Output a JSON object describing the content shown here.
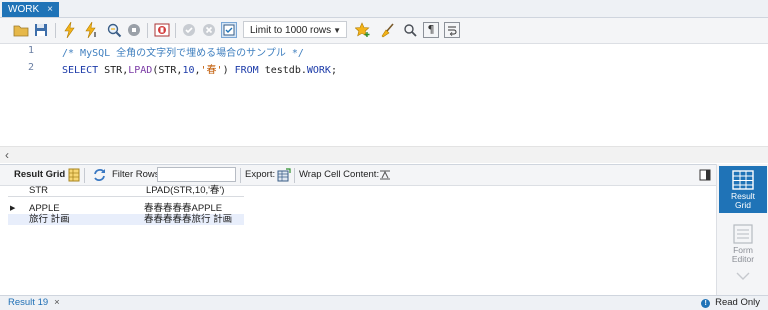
{
  "tab": {
    "title": "WORK",
    "close": "×"
  },
  "toolbar": {
    "limit_label": "Limit to 1000 rows"
  },
  "editor": {
    "lines": [
      {
        "number": "1",
        "comment": "/* MySQL 全角の文字列で埋める場合のサンプル */"
      },
      {
        "number": "2",
        "tokens": {
          "select": "SELECT",
          "cols": " STR,",
          "fn": "LPAD",
          "open": "(STR,",
          "num": "10",
          "comma": ",",
          "str": "'春'",
          "close": ")",
          "from": " FROM",
          "table_prefix": " testdb.",
          "table": "WORK",
          "end": ";"
        }
      }
    ]
  },
  "result_toolbar": {
    "result_grid": "Result Grid",
    "filter_rows": "Filter Rows:",
    "filter_value": "",
    "export": "Export:",
    "wrap": "Wrap Cell Content:"
  },
  "grid": {
    "columns": [
      "STR",
      "LPAD(STR,10,'春')"
    ],
    "rows": [
      [
        "APPLE",
        "春春春春春APPLE"
      ],
      [
        "旅行 計画",
        "春春春春春旅行 計画"
      ]
    ]
  },
  "side_panel": {
    "result_grid": [
      "Result",
      "Grid"
    ],
    "form_editor": [
      "Form",
      "Editor"
    ]
  },
  "status": {
    "result_tab": "Result 19",
    "close": "×",
    "mode": "Read Only"
  },
  "colors": {
    "accent": "#1f73b7",
    "keyword": "#1b3aa8",
    "comment": "#3f7fbf",
    "string": "#c05800"
  }
}
